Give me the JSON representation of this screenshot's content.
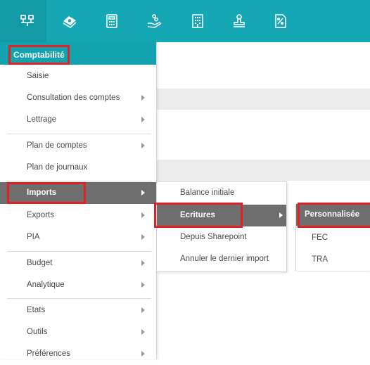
{
  "colors": {
    "topbar": "#15a7b4",
    "menu_header": "#12a3ae",
    "selected_item": "#6e6e6e",
    "highlight_border": "#e02024"
  },
  "toolbar": {
    "icons": [
      "modules-icon",
      "money-icon",
      "calculator-icon",
      "payment-icon",
      "building-icon",
      "stamp-icon",
      "percent-document-icon"
    ]
  },
  "menu": {
    "header": "Comptabilité",
    "items": [
      {
        "label": "Saisie",
        "submenu": false
      },
      {
        "label": "Consultation des comptes",
        "submenu": true
      },
      {
        "label": "Lettrage",
        "submenu": true
      },
      {
        "label": "Plan de comptes",
        "submenu": true
      },
      {
        "label": "Plan de journaux",
        "submenu": false
      },
      {
        "label": "Imports",
        "submenu": true,
        "selected": true
      },
      {
        "label": "Exports",
        "submenu": true
      },
      {
        "label": "PIA",
        "submenu": true
      },
      {
        "label": "Budget",
        "submenu": true
      },
      {
        "label": "Analytique",
        "submenu": true
      },
      {
        "label": "Etats",
        "submenu": true
      },
      {
        "label": "Outils",
        "submenu": true
      },
      {
        "label": "Préférences",
        "submenu": true
      }
    ]
  },
  "imports_submenu": {
    "items": [
      {
        "label": "Balance initiale",
        "submenu": false
      },
      {
        "label": "Ecritures",
        "submenu": true,
        "selected": true
      },
      {
        "label": "Depuis Sharepoint",
        "submenu": false
      },
      {
        "label": "Annuler le dernier import",
        "submenu": false
      }
    ]
  },
  "ecritures_submenu": {
    "items": [
      {
        "label": "Personnalisée",
        "selected": true
      },
      {
        "label": "FEC"
      },
      {
        "label": "TRA"
      }
    ]
  }
}
